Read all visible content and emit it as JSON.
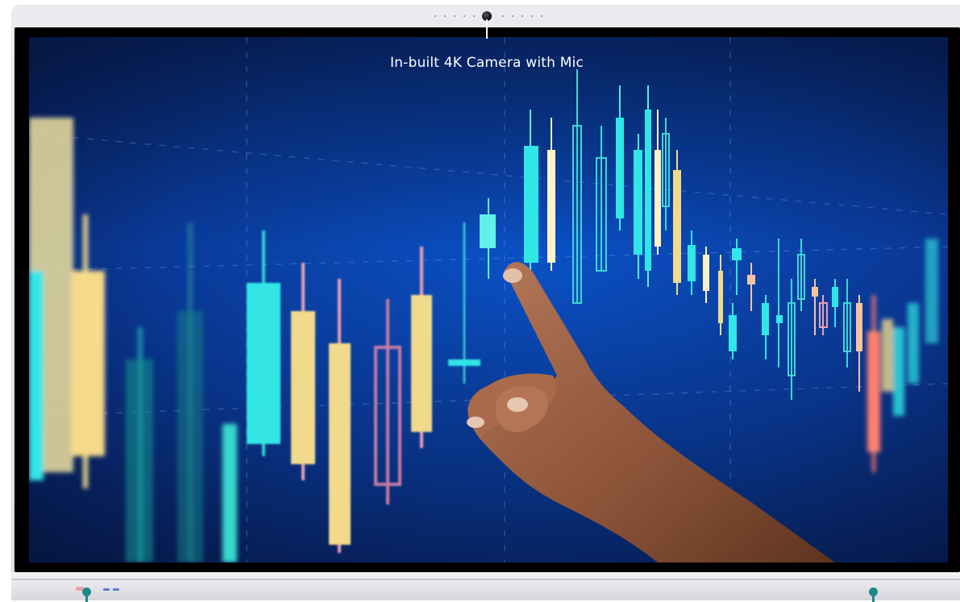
{
  "callout": {
    "label": "In-built 4K Camera with Mic"
  },
  "icons": {
    "camera": "camera-icon",
    "hand": "pointing-hand-icon",
    "indicator": "indicator-pin-icon",
    "ports": "usb-port-icon"
  },
  "colors": {
    "screen_bg_top": "#0b1f57",
    "screen_bg_center": "#0a46b8",
    "candle_cyan": "#30e6e6",
    "candle_yellow": "#f2da8c",
    "candle_pink": "#e9a0b5",
    "candle_red": "#ff7a6e",
    "indicator": "#1e8a86",
    "bezel": "#e3e1e6"
  }
}
